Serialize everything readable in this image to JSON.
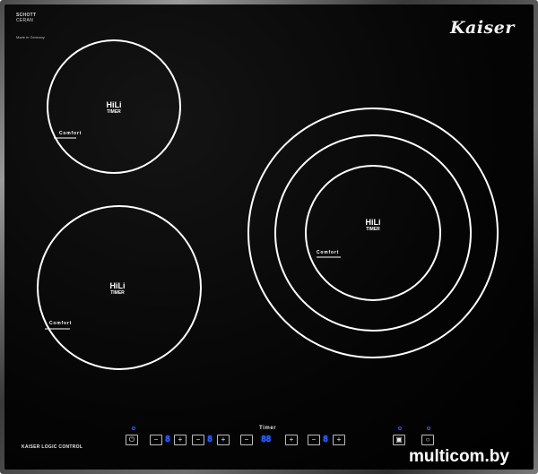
{
  "hob": {
    "glass_certification_line1": "SCHOTT",
    "glass_certification_line2": "CERAN",
    "origin": "Made in Germany",
    "brand": "Kaiser",
    "control_label": "KAISER LOGIC CONTROL",
    "timer_label": "Timer",
    "zones": [
      {
        "label": "HiLi",
        "sublabel": "TIMER",
        "comfort": "Comfort",
        "rings": 1
      },
      {
        "label": "HiLi",
        "sublabel": "TIMER",
        "comfort": "Comfort",
        "rings": 1
      },
      {
        "label": "HiLi",
        "sublabel": "TIMER",
        "comfort": "Comfort",
        "rings": 3
      }
    ],
    "controls": {
      "zone1_display": "8",
      "zone2_display": "8",
      "timer_display": "88",
      "zone3_display": "8"
    },
    "colors": {
      "glass": "#050505",
      "lines": "#ffffff",
      "display_blue": "#2f64ff"
    }
  },
  "watermark": "multicom.by"
}
